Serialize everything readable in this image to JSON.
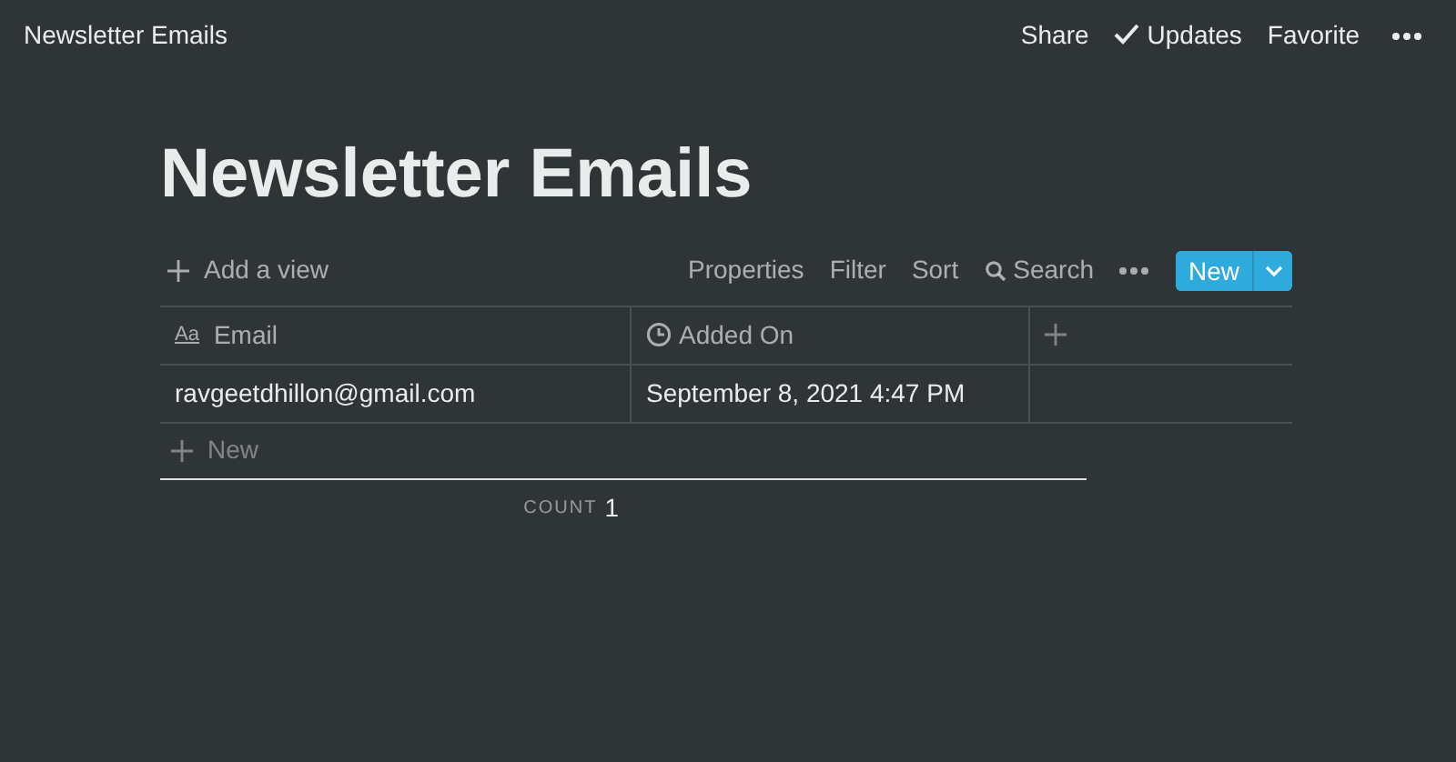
{
  "topbar": {
    "title": "Newsletter Emails",
    "actions": [
      {
        "label": "Share",
        "kind": "plain"
      },
      {
        "label": "Updates",
        "kind": "check"
      },
      {
        "label": "Favorite",
        "kind": "plain"
      }
    ]
  },
  "page": {
    "title": "Newsletter Emails"
  },
  "toolbar": {
    "add_view": "Add a view",
    "actions": [
      {
        "label": "Properties",
        "kind": "plain"
      },
      {
        "label": "Filter",
        "kind": "plain"
      },
      {
        "label": "Sort",
        "kind": "plain"
      },
      {
        "label": "Search",
        "kind": "search"
      }
    ],
    "new_button": "New"
  },
  "table": {
    "columns": [
      {
        "label": "Email",
        "kind": "text",
        "icon_text": "Aa"
      },
      {
        "label": "Added On",
        "kind": "date"
      }
    ],
    "rows": [
      {
        "cells": [
          "ravgeetdhillon@gmail.com",
          "September 8, 2021 4:47 PM"
        ]
      }
    ],
    "new_row": "New",
    "count_label": "COUNT",
    "count": "1"
  }
}
